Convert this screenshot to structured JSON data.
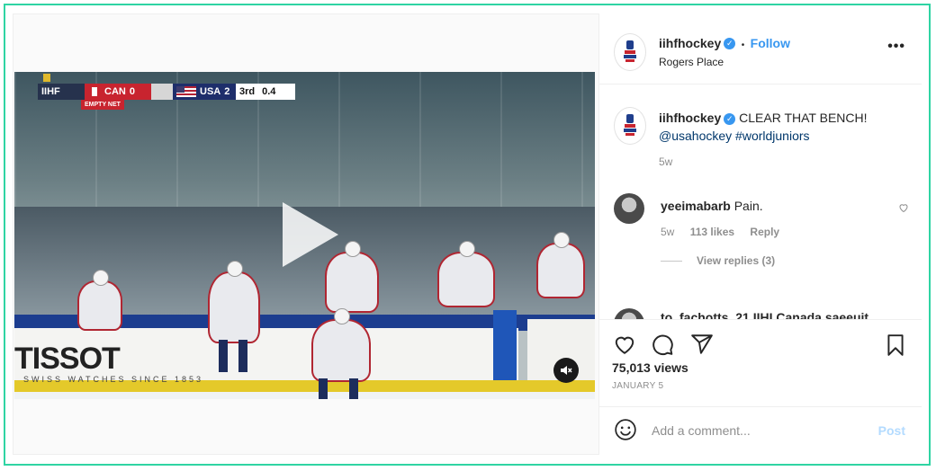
{
  "post": {
    "username": "iihfhockey",
    "location": "Rogers Place",
    "follow_label": "Follow",
    "dot": "•",
    "more_label": "•••"
  },
  "video": {
    "scoreboard": {
      "league": "IIHF",
      "team1": "CAN",
      "score1": "0",
      "team2": "USA",
      "score2": "2",
      "period": "3rd",
      "clock": "0.4",
      "empty_net": "EMPTY NET"
    },
    "sponsor": "TISSOT",
    "sponsor_sub": "SWISS WATCHES SINCE 1853"
  },
  "caption": {
    "username": "iihfhockey",
    "text": "CLEAR THAT BENCH!",
    "mention": "@usahockey",
    "hashtag": "#worldjuniors",
    "age": "5w"
  },
  "comments": [
    {
      "username": "yeeimabarb",
      "text": "Pain.",
      "age": "5w",
      "likes": "113 likes",
      "reply_label": "Reply",
      "view_replies": "View replies (3)"
    }
  ],
  "partial_comment": "to_fachotts_21 IIHI Canada saeeuit",
  "stats": {
    "views": "75,013 views",
    "date": "JANUARY 5"
  },
  "composer": {
    "placeholder": "Add a comment...",
    "post_label": "Post"
  },
  "colors": {
    "accent": "#3897f0",
    "border": "#2fd4a3"
  }
}
